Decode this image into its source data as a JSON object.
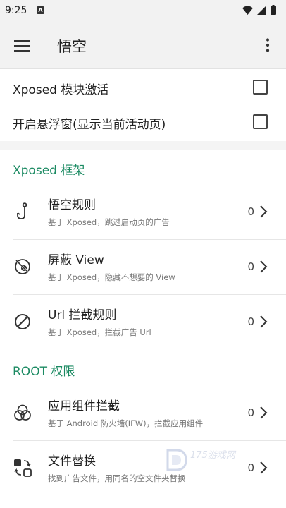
{
  "status_bar": {
    "time": "9:25",
    "notif_letter": "A"
  },
  "app_bar": {
    "title": "悟空"
  },
  "settings": [
    {
      "label": "Xposed 模块激活"
    },
    {
      "label": "开启悬浮窗(显示当前活动页)"
    }
  ],
  "xposed_section": {
    "title": "Xposed 框架",
    "items": [
      {
        "title": "悟空规则",
        "desc": "基于 Xposed，跳过启动页的广告",
        "count": "0",
        "icon": "hook-icon"
      },
      {
        "title": "屏蔽 View",
        "desc": "基于 Xposed，隐藏不想要的 View",
        "count": "0",
        "icon": "eye-off-icon"
      },
      {
        "title": "Url 拦截规则",
        "desc": "基于 Xposed，拦截广告 Url",
        "count": "0",
        "icon": "block-icon"
      }
    ]
  },
  "root_section": {
    "title": "ROOT 权限",
    "items": [
      {
        "title": "应用组件拦截",
        "desc": "基于 Android 防火墙(IFW)，拦截应用组件",
        "count": "0",
        "icon": "components-icon"
      },
      {
        "title": "文件替换",
        "desc": "找到广告文件，用同名的空文件夹替换",
        "count": "0",
        "icon": "file-swap-icon"
      }
    ]
  },
  "watermark": {
    "text": "175游戏网"
  }
}
